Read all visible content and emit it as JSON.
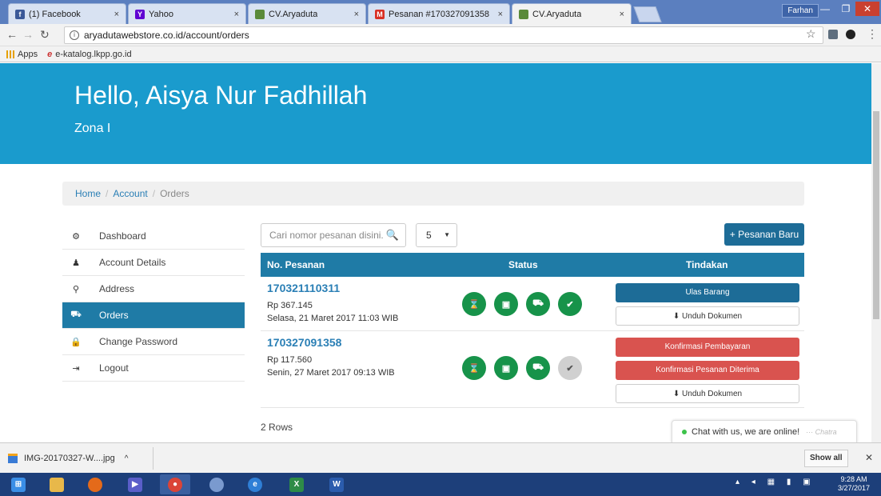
{
  "browser": {
    "tabs": [
      {
        "title": "(1) Facebook",
        "favicon": "facebook-icon",
        "color": "#3b5998",
        "glyph": "f"
      },
      {
        "title": "Yahoo",
        "favicon": "yahoo-icon",
        "color": "#6001d2",
        "glyph": "Y"
      },
      {
        "title": "CV.Aryaduta",
        "favicon": "site-icon",
        "color": "#5a8a3a",
        "glyph": ""
      },
      {
        "title": "Pesanan #170327091358",
        "favicon": "gmail-icon",
        "color": "#d93025",
        "glyph": "M"
      },
      {
        "title": "CV.Aryaduta",
        "favicon": "site-icon",
        "color": "#5a8a3a",
        "glyph": ""
      }
    ],
    "tab_close": "×",
    "profile": "Farhan",
    "url": "aryadutawebstore.co.id/account/orders",
    "bookmarks": [
      {
        "label": "Apps",
        "icon": "apps-grid-icon"
      },
      {
        "label": "e-katalog.lkpp.go.id",
        "icon": "ekatalog-icon"
      }
    ]
  },
  "hero": {
    "greeting": "Hello, Aisya Nur Fadhillah",
    "zone": "Zona I",
    "color": "#1a9bcd"
  },
  "breadcrumb": {
    "home": "Home",
    "account": "Account",
    "current": "Orders"
  },
  "sidebar": {
    "items": [
      {
        "label": "Dashboard",
        "icon": "dashboard-icon",
        "glyph": "⚙"
      },
      {
        "label": "Account Details",
        "icon": "user-icon",
        "glyph": "♟"
      },
      {
        "label": "Address",
        "icon": "map-marker-icon",
        "glyph": "⚲"
      },
      {
        "label": "Orders",
        "icon": "cart-icon",
        "glyph": "⛟",
        "active": true
      },
      {
        "label": "Change Password",
        "icon": "lock-icon",
        "glyph": "🔒"
      },
      {
        "label": "Logout",
        "icon": "logout-icon",
        "glyph": "⇥"
      }
    ]
  },
  "toolbar": {
    "search_placeholder": "Cari nomor pesanan disini.",
    "page_size": "5",
    "new_order": "+ Pesanan Baru"
  },
  "table": {
    "headers": {
      "order": "No. Pesanan",
      "status": "Status",
      "action": "Tindakan"
    },
    "rows": [
      {
        "id": "170321110311",
        "price": "Rp 367.145",
        "date": "Selasa, 21 Maret 2017 11:03 WIB",
        "statuses": [
          true,
          true,
          true,
          true
        ],
        "actions": [
          {
            "label": "Ulas Barang",
            "style": "primary"
          },
          {
            "label": "⬇ Unduh Dokumen",
            "style": "default"
          }
        ]
      },
      {
        "id": "170327091358",
        "price": "Rp 117.560",
        "date": "Senin, 27 Maret 2017 09:13 WIB",
        "statuses": [
          true,
          true,
          true,
          false
        ],
        "actions": [
          {
            "label": "Konfirmasi Pembayaran",
            "style": "danger"
          },
          {
            "label": "Konfirmasi Pesanan Diterima",
            "style": "danger"
          },
          {
            "label": "⬇ Unduh Dokumen",
            "style": "default"
          }
        ]
      }
    ],
    "status_icons": [
      "hourglass-icon",
      "money-icon",
      "truck-icon",
      "check-icon"
    ],
    "status_glyphs": [
      "⌛",
      "▣",
      "⛟",
      "✔"
    ],
    "rows_count": "2 Rows"
  },
  "chat": {
    "text": "Chat with us, we are online!",
    "brand": "··· Chatra"
  },
  "downloads": {
    "file": "IMG-20170327-W....jpg",
    "show_all": "Show all"
  },
  "taskbar": {
    "time": "9:28 AM",
    "date": "3/27/2017"
  }
}
